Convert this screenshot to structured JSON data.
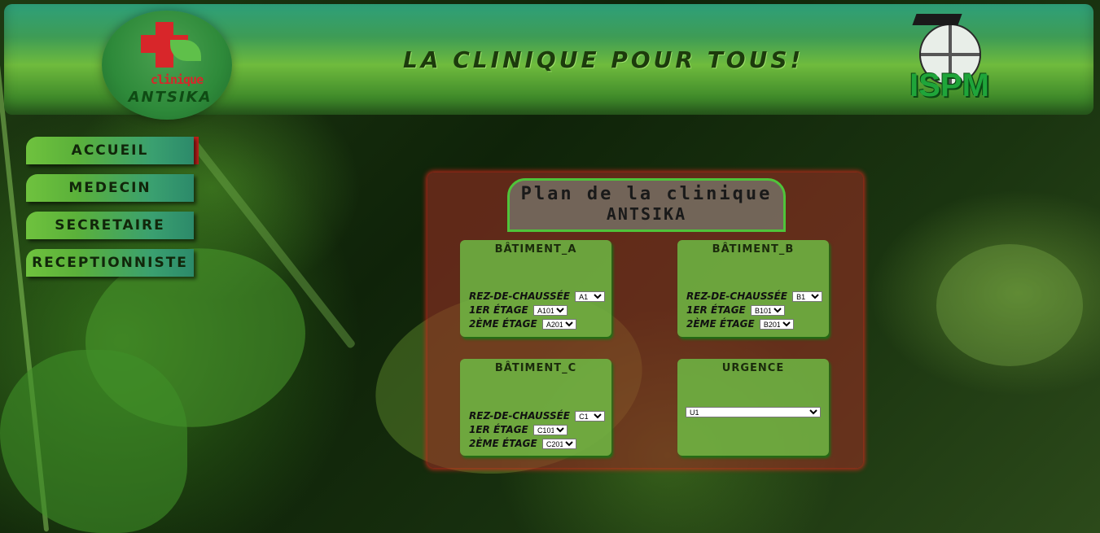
{
  "header": {
    "logo_line1": "clinique",
    "logo_line2": "ANTSIKA",
    "site_title": "LA CLINIQUE POUR TOUS!",
    "partner_logo_text": "ISPM"
  },
  "nav": {
    "items": [
      {
        "label": "ACCUEIL",
        "active": true
      },
      {
        "label": "MEDECIN",
        "active": false
      },
      {
        "label": "SECRETAIRE",
        "active": false
      },
      {
        "label": "RECEPTIONNISTE",
        "active": false
      }
    ]
  },
  "plan": {
    "title_line1": "Plan de la clinique",
    "title_line2": "ANTSIKA",
    "buildings": [
      {
        "title": "BÂTIMENT_A",
        "floors": [
          {
            "label": "REZ-DE-CHAUSSÉE",
            "selected": "A1"
          },
          {
            "label": "1ER ÉTAGE",
            "selected": "A101"
          },
          {
            "label": "2ÈME ÉTAGE",
            "selected": "A201"
          }
        ]
      },
      {
        "title": "BÂTIMENT_B",
        "floors": [
          {
            "label": "REZ-DE-CHAUSSÉE",
            "selected": "B1"
          },
          {
            "label": "1ER ÉTAGE",
            "selected": "B101"
          },
          {
            "label": "2ÈME ÉTAGE",
            "selected": "B201"
          }
        ]
      },
      {
        "title": "BÂTIMENT_C",
        "floors": [
          {
            "label": "REZ-DE-CHAUSSÉE",
            "selected": "C1"
          },
          {
            "label": "1ER ÉTAGE",
            "selected": "C101"
          },
          {
            "label": "2ÈME ÉTAGE",
            "selected": "C201"
          }
        ]
      }
    ],
    "urgence": {
      "title": "URGENCE",
      "selected": "U1"
    }
  },
  "colors": {
    "panel_glow": "#d2281e",
    "title_border": "#4fc43a",
    "nav_active_marker": "#c0201a"
  }
}
